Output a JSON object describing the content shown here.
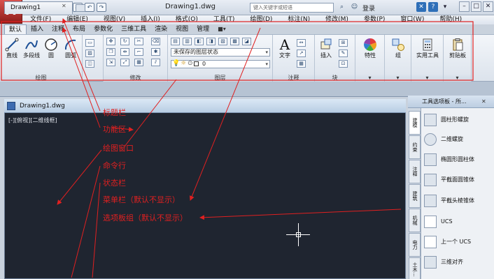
{
  "app": {
    "logo_letter": "A",
    "document_title": "Drawing1.dwg",
    "search_placeholder": "键入关键字或短语",
    "login_label": "登录",
    "title_ctrl_icons": [
      "✕",
      "?",
      "▾"
    ],
    "win_ctrls": [
      "–",
      "□",
      "✕"
    ]
  },
  "menubar": {
    "items": [
      "文件(F)",
      "编辑(E)",
      "视图(V)",
      "插入(I)",
      "格式(O)",
      "工具(T)",
      "绘图(D)",
      "标注(N)",
      "修改(M)",
      "参数(P)",
      "窗口(W)",
      "帮助(H)"
    ]
  },
  "ribbon": {
    "tabs": [
      "默认",
      "插入",
      "注释",
      "布局",
      "参数化",
      "三维工具",
      "渲染",
      "视图",
      "管理"
    ],
    "active_tab": "默认",
    "panels": {
      "draw": {
        "label": "绘图",
        "tools": [
          "直线",
          "多段线",
          "圆",
          "圆弧"
        ]
      },
      "modify": {
        "label": "修改"
      },
      "layers": {
        "label": "图层",
        "layer_state": "未保存的图层状态",
        "current_layer": "0"
      },
      "annotation": {
        "label": "注释",
        "text_tool": "文字"
      },
      "block": {
        "label": "块",
        "insert_tool": "插入"
      },
      "properties": {
        "label": "特性"
      },
      "group": {
        "label": "组"
      },
      "utilities": {
        "label": "实用工具"
      },
      "clipboard": {
        "label": "剪贴板"
      }
    }
  },
  "document_tab": {
    "label": "Drawing1",
    "close": "✕"
  },
  "drawing_window": {
    "title": "Drawing1.dwg",
    "view_label": "[-][俯视][二维线框]"
  },
  "annotations": [
    "标题栏",
    "功能区",
    "绘图窗口",
    "命令行",
    "状态栏",
    "菜单栏（默认不显示）",
    "选项板组（默认不显示）"
  ],
  "palette": {
    "title": "工具选项板 - 所...",
    "close": "✕",
    "tabs": [
      "建模",
      "约束",
      "注释",
      "建筑",
      "机械",
      "电力",
      "土木..."
    ],
    "items": [
      "圆柱形螺旋",
      "二维螺旋",
      "椭圆形圆柱体",
      "平截面圆锥体",
      "平截头棱锥体",
      "UCS",
      "上一个 UCS",
      "三维对齐"
    ]
  },
  "colors": {
    "annotation_red": "#e02020",
    "drawing_background": "#1f2530"
  }
}
